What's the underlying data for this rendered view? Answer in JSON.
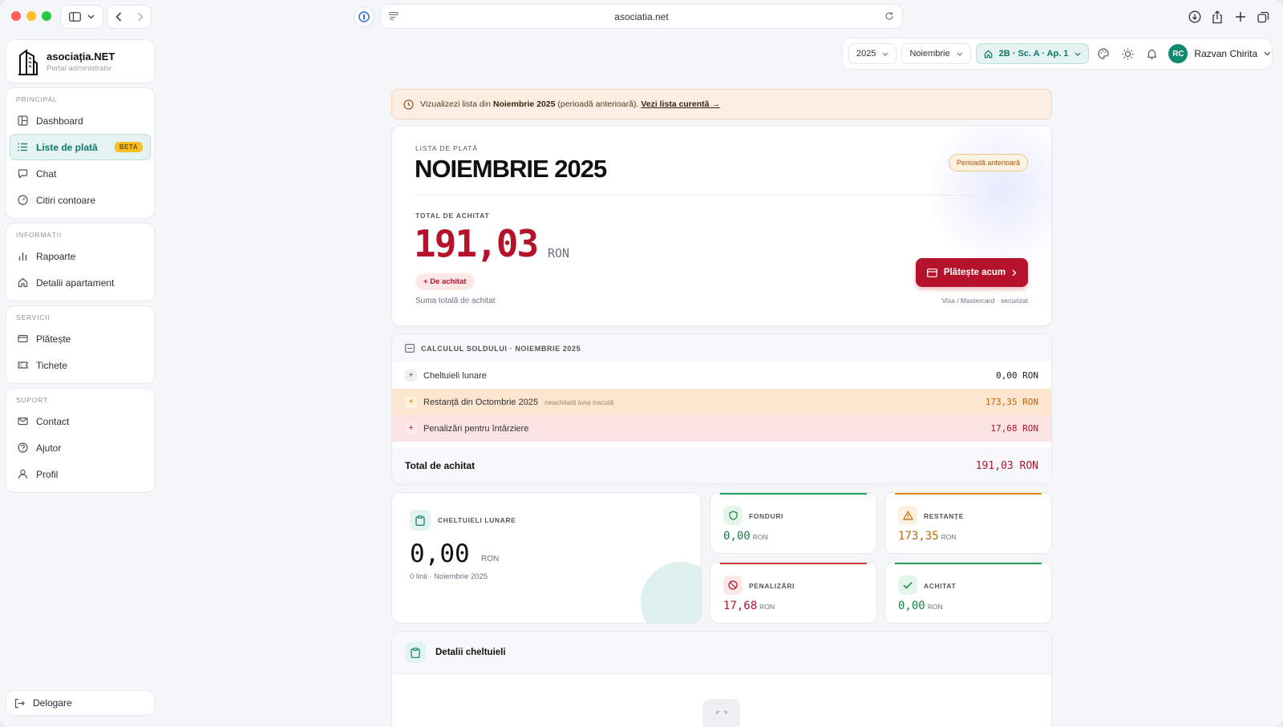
{
  "browser": {
    "url": "asociatia.net"
  },
  "brand": {
    "name": "asociația.NET",
    "subtitle": "Portal administrativ"
  },
  "sidebar": {
    "sections": [
      {
        "title": "PRINCIPAL",
        "items": [
          {
            "label": "Dashboard",
            "icon": "dashboard-icon"
          },
          {
            "label": "Liste de plată",
            "icon": "list-icon",
            "badge": "BETA",
            "active": true
          },
          {
            "label": "Chat",
            "icon": "chat-icon"
          },
          {
            "label": "Citiri contoare",
            "icon": "meter-icon"
          }
        ]
      },
      {
        "title": "INFORMAȚII",
        "items": [
          {
            "label": "Rapoarte",
            "icon": "bar-chart-icon"
          },
          {
            "label": "Detalii apartament",
            "icon": "home-icon"
          }
        ]
      },
      {
        "title": "SERVICII",
        "items": [
          {
            "label": "Plătește",
            "icon": "card-icon"
          },
          {
            "label": "Tichete",
            "icon": "ticket-icon"
          }
        ]
      },
      {
        "title": "SUPORT",
        "items": [
          {
            "label": "Contact",
            "icon": "mail-icon"
          },
          {
            "label": "Ajutor",
            "icon": "help-icon"
          },
          {
            "label": "Profil",
            "icon": "user-icon"
          }
        ]
      }
    ],
    "logout": "Delogare"
  },
  "toolbar": {
    "year": "2025",
    "month": "Noiembrie",
    "apartment": "2B · Sc. A · Ap. 1",
    "avatar_initials": "RC",
    "user_name": "Razvan Chirita"
  },
  "banner": {
    "prefix": "Vizualizezi lista din",
    "period": "Noiembrie 2025",
    "suffix": "(perioadă anterioară).",
    "link": "Vezi lista curentă →"
  },
  "hero": {
    "eyebrow": "LISTA DE PLATĂ",
    "title": "NOIEMBRIE 2025",
    "period_badge": "Perioadă anterioară",
    "total_label": "TOTAL DE ACHITAT",
    "amount": "191,03",
    "currency": "RON",
    "due_badge": "De achitat",
    "subtext": "Suma totală de achitat",
    "pay_button": "Plătește acum",
    "pay_note": "Visa / Mastercard · securizat"
  },
  "calc": {
    "title": "CALCULUL SOLDULUI · NOIEMBRIE 2025",
    "rows": [
      {
        "label": "Cheltuieli lunare",
        "value": "0,00 RON",
        "note": ""
      },
      {
        "label": "Restanță din Octombrie 2025",
        "value": "173,35 RON",
        "note": "neachitată luna trecută"
      },
      {
        "label": "Penalizări pentru întârziere",
        "value": "17,68 RON",
        "note": ""
      }
    ],
    "total_label": "Total de achitat",
    "total_value": "191,03 RON"
  },
  "stats": {
    "monthly": {
      "label": "CHELTUIELI LUNARE",
      "value": "0,00",
      "currency": "RON",
      "sub": "0 linii · Noiembrie 2025"
    },
    "cards": [
      {
        "label": "FONDURI",
        "value": "0,00",
        "currency": "RON",
        "color": "#15803d",
        "bar": "#22a05a",
        "icon": "shield-icon"
      },
      {
        "label": "RESTANȚE",
        "value": "173,35",
        "currency": "RON",
        "color": "#c2670a",
        "bar": "#e28a17",
        "icon": "warning-icon"
      },
      {
        "label": "PENALIZĂRI",
        "value": "17,68",
        "currency": "RON",
        "color": "#b5122b",
        "bar": "#d23b3b",
        "icon": "ban-icon"
      },
      {
        "label": "ACHITAT",
        "value": "0,00",
        "currency": "RON",
        "color": "#15803d",
        "bar": "#22a05a",
        "icon": "check-icon"
      }
    ]
  },
  "details": {
    "title": "Detalii cheltuieli"
  }
}
